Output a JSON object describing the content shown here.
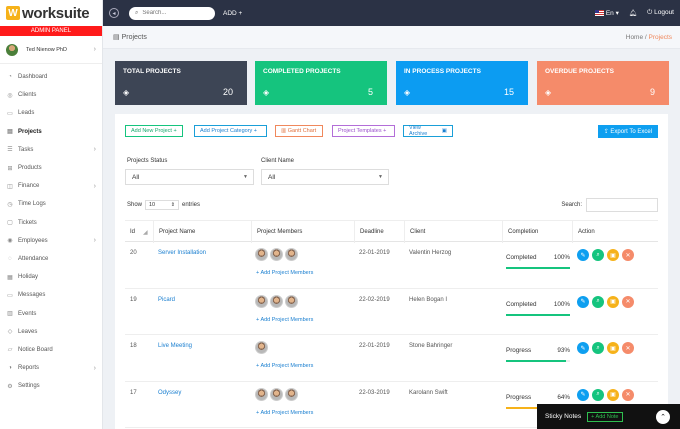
{
  "brand": {
    "name": "worksuite",
    "mark": "W",
    "panel_label": "ADMIN PANEL"
  },
  "user": {
    "name": "Ted Nienow PhD"
  },
  "sidebar": {
    "items": [
      {
        "label": "Dashboard",
        "icon": "dashboard-icon",
        "glyph": "◔"
      },
      {
        "label": "Clients",
        "icon": "clients-icon",
        "glyph": "◎"
      },
      {
        "label": "Leads",
        "icon": "leads-icon",
        "glyph": "▭"
      },
      {
        "label": "Projects",
        "icon": "projects-icon",
        "glyph": "▤"
      },
      {
        "label": "Tasks",
        "icon": "tasks-icon",
        "glyph": "☰"
      },
      {
        "label": "Products",
        "icon": "products-icon",
        "glyph": "⊞"
      },
      {
        "label": "Finance",
        "icon": "finance-icon",
        "glyph": "◫"
      },
      {
        "label": "Time Logs",
        "icon": "time-logs-icon",
        "glyph": "◷"
      },
      {
        "label": "Tickets",
        "icon": "tickets-icon",
        "glyph": "▢"
      },
      {
        "label": "Employees",
        "icon": "employees-icon",
        "glyph": "◉"
      },
      {
        "label": "Attendance",
        "icon": "attendance-icon",
        "glyph": "◌"
      },
      {
        "label": "Holiday",
        "icon": "holiday-icon",
        "glyph": "▦"
      },
      {
        "label": "Messages",
        "icon": "messages-icon",
        "glyph": "▭"
      },
      {
        "label": "Events",
        "icon": "events-icon",
        "glyph": "▥"
      },
      {
        "label": "Leaves",
        "icon": "leaves-icon",
        "glyph": "◇"
      },
      {
        "label": "Notice Board",
        "icon": "notice-board-icon",
        "glyph": "▱"
      },
      {
        "label": "Reports",
        "icon": "reports-icon",
        "glyph": "◑"
      },
      {
        "label": "Settings",
        "icon": "settings-icon",
        "glyph": "⚙"
      }
    ]
  },
  "topbar": {
    "search_placeholder": "Search...",
    "add_label": "ADD",
    "language": "En",
    "logout_label": "Logout"
  },
  "breadcrumb": {
    "title": "Projects",
    "home": "Home",
    "current": "Projects"
  },
  "stats": [
    {
      "title": "TOTAL PROJECTS",
      "value": "20",
      "color": "#3d4555"
    },
    {
      "title": "COMPLETED PROJECTS",
      "value": "5",
      "color": "#15c47e"
    },
    {
      "title": "IN PROCESS PROJECTS",
      "value": "15",
      "color": "#0c9cf2"
    },
    {
      "title": "OVERDUE PROJECTS",
      "value": "9",
      "color": "#f58b6a"
    }
  ],
  "toolbar": {
    "add_project": "Add New Project",
    "add_category": "Add Project Category",
    "gantt": "Gantt Chart",
    "templates": "Project Templates",
    "archive": "View Archive",
    "export": "Export To Excel"
  },
  "filters": {
    "status_label": "Projects Status",
    "status_value": "All",
    "client_label": "Client Name",
    "client_value": "All"
  },
  "table_controls": {
    "show_label": "Show",
    "entries_value": "10",
    "entries_label": "entries",
    "search_label": "Search:"
  },
  "table": {
    "columns": [
      "Id",
      "Project Name",
      "Project Members",
      "Deadline",
      "Client",
      "Completion",
      "Action"
    ],
    "add_member_label": "Add Project Members",
    "rows": [
      {
        "id": "20",
        "name": "Server Installation",
        "members": 3,
        "deadline": "22-01-2019",
        "client": "Valentin Herzog",
        "status": "Completed",
        "percent": "100%",
        "progress": 1.0,
        "bar_color": "#15c47e"
      },
      {
        "id": "19",
        "name": "Picard",
        "members": 3,
        "deadline": "22-02-2019",
        "client": "Helen Bogan I",
        "status": "Completed",
        "percent": "100%",
        "progress": 1.0,
        "bar_color": "#15c47e"
      },
      {
        "id": "18",
        "name": "Live Meeting",
        "members": 1,
        "deadline": "22-01-2019",
        "client": "Stone Bahringer",
        "status": "Progress",
        "percent": "93%",
        "progress": 0.93,
        "bar_color": "#15c47e"
      },
      {
        "id": "17",
        "name": "Odyssey",
        "members": 3,
        "deadline": "22-03-2019",
        "client": "Karolann Swift",
        "status": "Progress",
        "percent": "64%",
        "progress": 0.64,
        "bar_color": "#f6b21a"
      }
    ]
  },
  "sticky": {
    "label": "Sticky Notes",
    "add_label": "+ Add Note"
  }
}
